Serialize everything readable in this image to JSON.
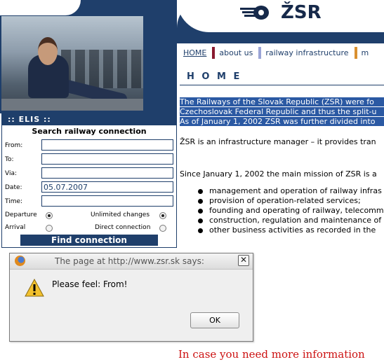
{
  "site": {
    "logo_text": "ŽSR",
    "nav": [
      "HOME",
      "about us",
      "railway infrastructure",
      "m"
    ],
    "page_heading": "H O M E"
  },
  "intro_highlight": [
    "The Railways of the Slovak Republic (ZSR) were fo",
    "Czechoslovak Federal Republic and thus the split-u",
    "As of January 1, 2002 ZSR was further divided into"
  ],
  "para_manager": "ŽSR is an infrastructure manager – it provides tran",
  "para_mission": "Since January 1, 2002 the main mission of ZSR is a",
  "bullets": [
    "management and operation of railway infras",
    "provision of operation-related services;",
    "founding and operating of railway, telecomm",
    "construction, regulation and maintenance of",
    "other business activities as recorded in the"
  ],
  "footer_red": "In case you need more information",
  "elis": {
    "header": ":: ELIS ::",
    "title": "Search railway connection",
    "fields": [
      {
        "label": "From:",
        "value": ""
      },
      {
        "label": "To:",
        "value": ""
      },
      {
        "label": "Via:",
        "value": ""
      },
      {
        "label": "Date:",
        "value": "05.07.2007"
      },
      {
        "label": "Time:",
        "value": ""
      }
    ],
    "departure_label": "Departure",
    "arrival_label": "Arrival",
    "unlimited_label": "Unlimited changes",
    "direct_label": "Direct connection",
    "departure_selected": true,
    "unlimited_selected": true,
    "find_button": "Find connection"
  },
  "alert": {
    "title": "The page at http://www.zsr.sk says:",
    "message": "Please feel: From!",
    "ok_label": "OK",
    "close_glyph": "✕"
  }
}
